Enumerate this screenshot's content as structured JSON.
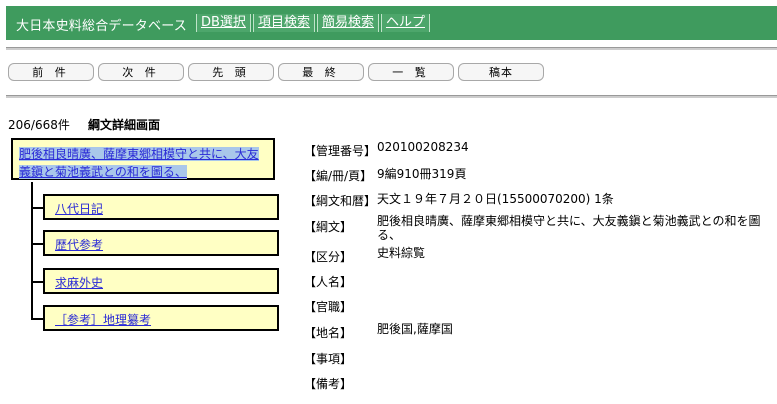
{
  "header": {
    "app_title": "大日本史料総合データベース",
    "nav": [
      "DB選択",
      "項目検索",
      "簡易検索",
      "ヘルプ"
    ]
  },
  "toolbar": {
    "buttons": [
      "前 件",
      "次 件",
      "先 頭",
      "最 終",
      "一 覧",
      "稿本"
    ]
  },
  "status": {
    "count": "206/668件",
    "page_title": "綱文詳細画面"
  },
  "tree": {
    "main_line1": "肥後相良晴廣、薩摩東郷相模守と共に、大友",
    "main_line2": "義鎭と菊池義武との和を圖る、",
    "children": [
      "八代日記",
      "歴代参考",
      "求麻外史",
      "［参考］地理纂考"
    ]
  },
  "details": {
    "fields": [
      {
        "label": "【管理番号】",
        "value": "020100208234"
      },
      {
        "label": "【編/冊/頁】",
        "value": "9編910冊319頁"
      },
      {
        "label": "【綱文和暦】",
        "value": "天文１９年７月２０日(15500070200) 1条"
      },
      {
        "label": "【綱文】",
        "value": "肥後相良晴廣、薩摩東郷相模守と共に、大友義鎭と菊池義武との和を圖る、"
      },
      {
        "label": "【区分】",
        "value": "史料綜覧"
      },
      {
        "label": "【人名】",
        "value": ""
      },
      {
        "label": "【官職】",
        "value": ""
      },
      {
        "label": "【地名】",
        "value": "肥後国,薩摩国"
      },
      {
        "label": "【事項】",
        "value": ""
      },
      {
        "label": "【備考】",
        "value": ""
      }
    ]
  }
}
